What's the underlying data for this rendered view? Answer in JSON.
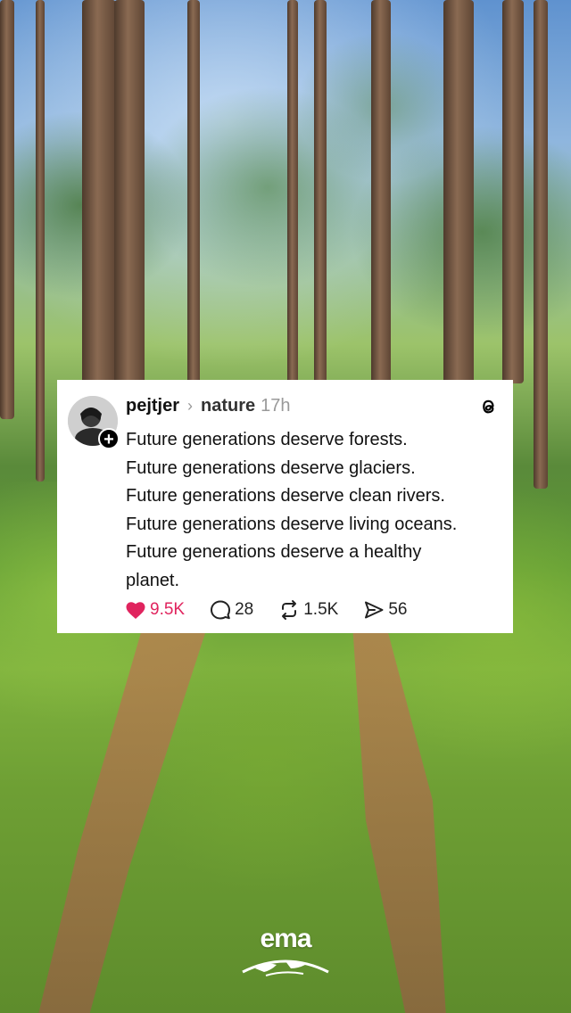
{
  "post": {
    "username": "pejtjer",
    "topic": "nature",
    "time": "17h",
    "lines": [
      "Future generations deserve forests.",
      "Future generations deserve glaciers.",
      "Future generations deserve clean rivers.",
      "Future generations deserve living oceans.",
      "Future generations deserve a healthy",
      "planet."
    ],
    "likes": "9.5K",
    "replies": "28",
    "reposts": "1.5K",
    "shares": "56"
  },
  "icons": {
    "logo": "threads-logo-icon",
    "like": "heart-icon",
    "reply": "comment-bubble-icon",
    "repost": "repost-arrows-icon",
    "share": "send-plane-icon",
    "follow": "plus-icon"
  },
  "colors": {
    "like": "#e0245e",
    "card_bg": "#ffffff",
    "text": "#111111",
    "muted": "#999999"
  },
  "watermark": {
    "text": "ema"
  }
}
